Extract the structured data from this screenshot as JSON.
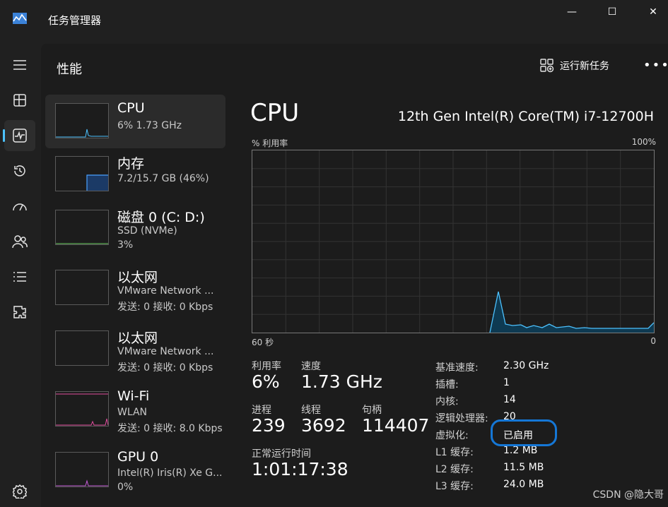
{
  "window": {
    "title": "任务管理器",
    "minimize": "—",
    "maximize": "☐",
    "close": "✕"
  },
  "header": {
    "title": "性能",
    "run_task": "运行新任务",
    "more": "•••"
  },
  "nav": [
    {
      "name": "hamburger-menu-icon"
    },
    {
      "name": "processes-icon"
    },
    {
      "name": "performance-icon",
      "active": true
    },
    {
      "name": "app-history-icon"
    },
    {
      "name": "startup-apps-icon"
    },
    {
      "name": "users-icon"
    },
    {
      "name": "details-icon"
    },
    {
      "name": "services-icon"
    },
    {
      "name": "settings-icon"
    }
  ],
  "devices": [
    {
      "name": "CPU",
      "sub1": "6% 1.73 GHz",
      "sub2": ""
    },
    {
      "name": "内存",
      "sub1": "7.2/15.7 GB (46%)",
      "sub2": ""
    },
    {
      "name": "磁盘 0 (C: D:)",
      "sub1": "SSD (NVMe)",
      "sub2": "3%"
    },
    {
      "name": "以太网",
      "sub1": "VMware Network ...",
      "sub2": "发送: 0 接收: 0 Kbps"
    },
    {
      "name": "以太网",
      "sub1": "VMware Network ...",
      "sub2": "发送: 0 接收: 0 Kbps"
    },
    {
      "name": "Wi-Fi",
      "sub1": "WLAN",
      "sub2": "发送: 0 接收: 8.0 Kbps"
    },
    {
      "name": "GPU 0",
      "sub1": "Intel(R) Iris(R) Xe G...",
      "sub2": "0%"
    }
  ],
  "detail": {
    "title": "CPU",
    "model": "12th Gen Intel(R) Core(TM) i7-12700H",
    "graph_label": "% 利用率",
    "graph_max": "100%",
    "graph_time": "60 秒",
    "graph_zero": "0",
    "stats": {
      "util_label": "利用率",
      "util_value": "6%",
      "speed_label": "速度",
      "speed_value": "1.73 GHz",
      "proc_label": "进程",
      "proc_value": "239",
      "thread_label": "线程",
      "thread_value": "3692",
      "handle_label": "句柄",
      "handle_value": "114407",
      "uptime_label": "正常运行时间",
      "uptime_value": "1:01:17:38"
    },
    "specs": [
      {
        "label": "基准速度:",
        "value": "2.30 GHz"
      },
      {
        "label": "插槽:",
        "value": "1"
      },
      {
        "label": "内核:",
        "value": "14"
      },
      {
        "label": "逻辑处理器:",
        "value": "20"
      },
      {
        "label": "虚拟化:",
        "value": "已启用"
      },
      {
        "label": "L1 缓存:",
        "value": "1.2 MB"
      },
      {
        "label": "L2 缓存:",
        "value": "11.5 MB"
      },
      {
        "label": "L3 缓存:",
        "value": "24.0 MB"
      }
    ]
  },
  "colors": {
    "cpu": "#4cc2ff",
    "memory": "#4aa0ff",
    "wifi": "#e14c9c",
    "gpu": "#c45cd6",
    "accent": "#1577d6"
  },
  "watermark": "CSDN @隐大哥"
}
